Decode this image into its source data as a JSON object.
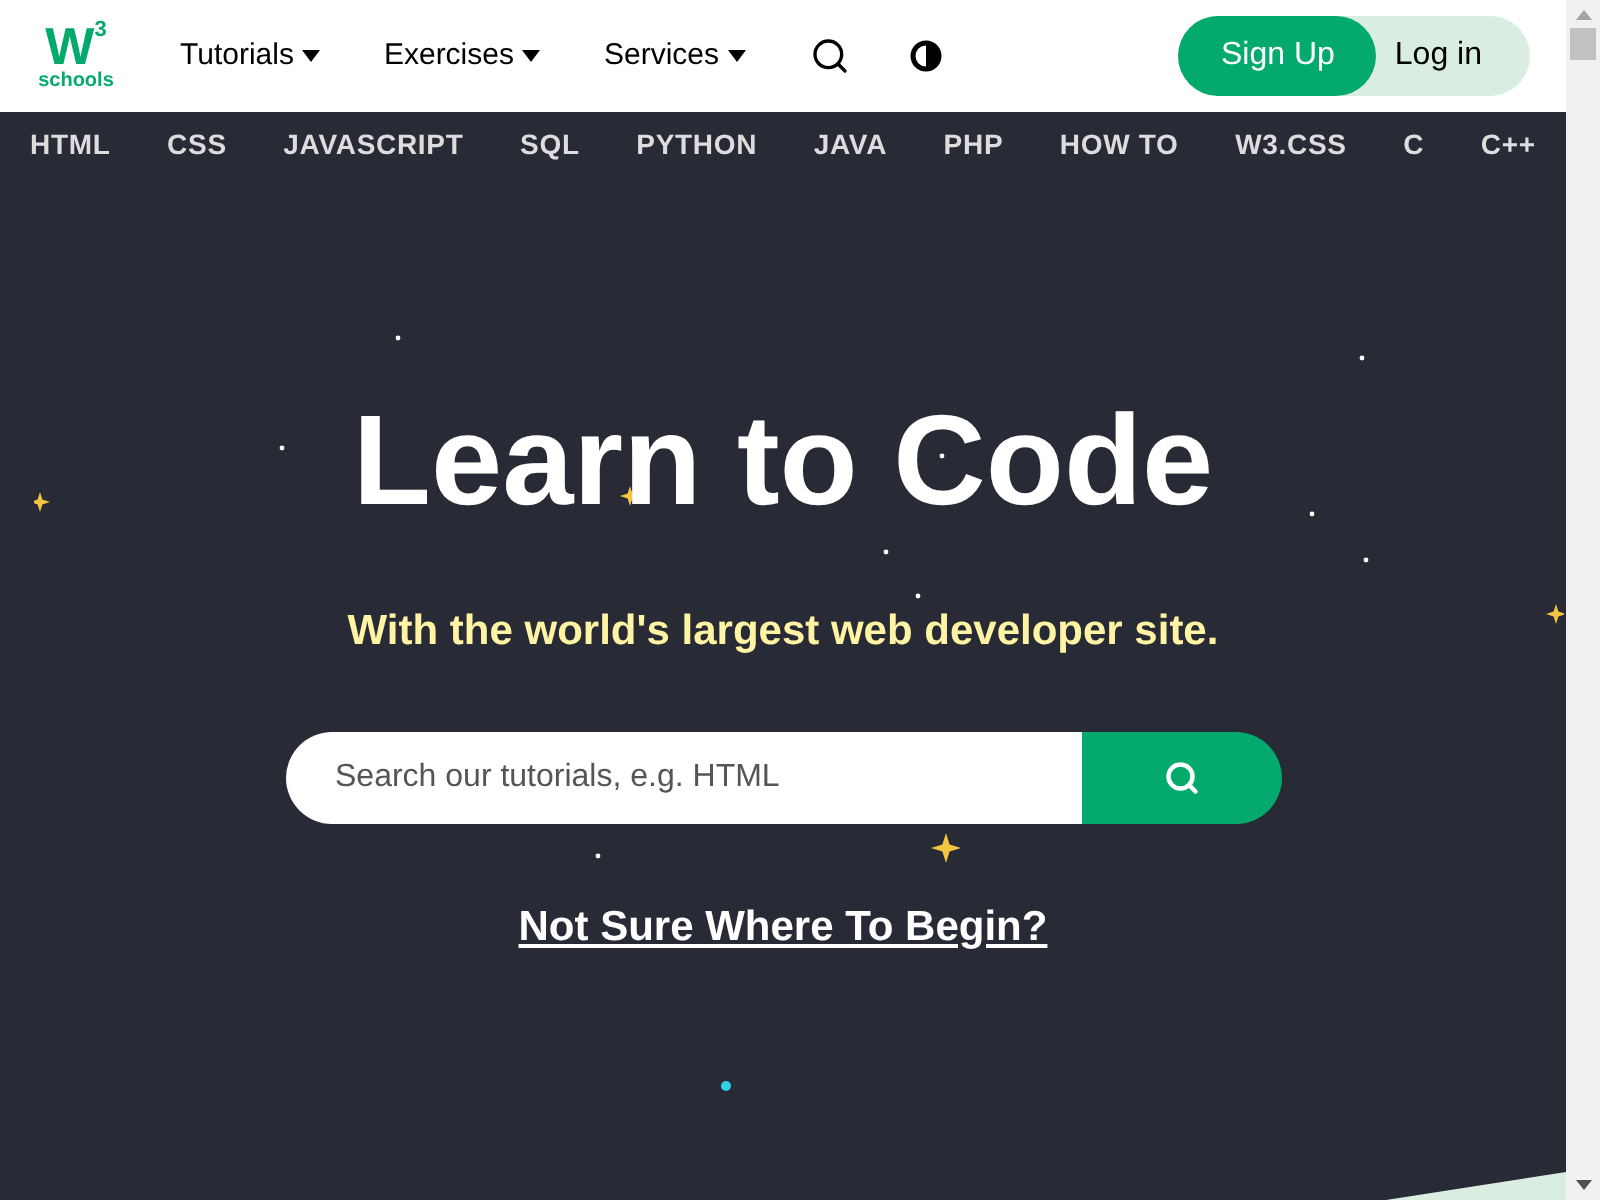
{
  "logo": {
    "mark": "W",
    "superscript": "3",
    "word": "schools"
  },
  "menu": [
    {
      "label": "Tutorials"
    },
    {
      "label": "Exercises"
    },
    {
      "label": "Services"
    }
  ],
  "auth": {
    "signup": "Sign Up",
    "login": "Log in"
  },
  "topics": [
    "HTML",
    "CSS",
    "JAVASCRIPT",
    "SQL",
    "PYTHON",
    "JAVA",
    "PHP",
    "HOW TO",
    "W3.CSS",
    "C",
    "C++"
  ],
  "hero": {
    "title": "Learn to Code",
    "subtitle": "With the world's largest web developer site.",
    "search": {
      "placeholder": "Search our tutorials, e.g. HTML"
    },
    "link": "Not Sure Where To Begin?"
  }
}
